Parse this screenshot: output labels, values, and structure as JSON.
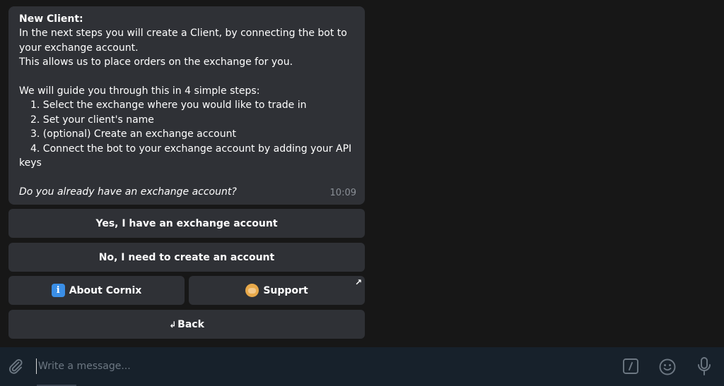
{
  "message": {
    "title": "New Client:",
    "intro_lines": [
      "In the next steps you will create a Client, by connecting the bot to",
      "your exchange account.",
      "This allows us to place orders on the exchange for you."
    ],
    "guide_line": "We will guide you through this in 4 simple steps:",
    "steps": [
      "1. Select the exchange where you would like to trade in",
      "2. Set your client's name",
      "3. (optional) Create an exchange account",
      "4. Connect the bot to your exchange account by adding your API"
    ],
    "steps_wrap": "keys",
    "question": "Do you already have an exchange account?",
    "time": "10:09"
  },
  "keyboard": {
    "yes_label": "Yes, I have an exchange account",
    "no_label": "No, I need to create an account",
    "about_label": "About Cornix",
    "about_icon": "info-icon",
    "support_label": "Support",
    "support_icon": "support-person-icon",
    "back_label": "Back",
    "back_symbol": "↲",
    "external_symbol": "↗"
  },
  "composer": {
    "placeholder": "Write a message...",
    "icons": [
      "paperclip-icon",
      "bot-command-icon",
      "emoji-icon",
      "microphone-icon"
    ]
  },
  "colors": {
    "chat_bg": "#171717",
    "bubble_bg": "#2f3136",
    "composer_bg": "#17212b",
    "text": "#ffffff",
    "muted": "#8a8f96"
  }
}
